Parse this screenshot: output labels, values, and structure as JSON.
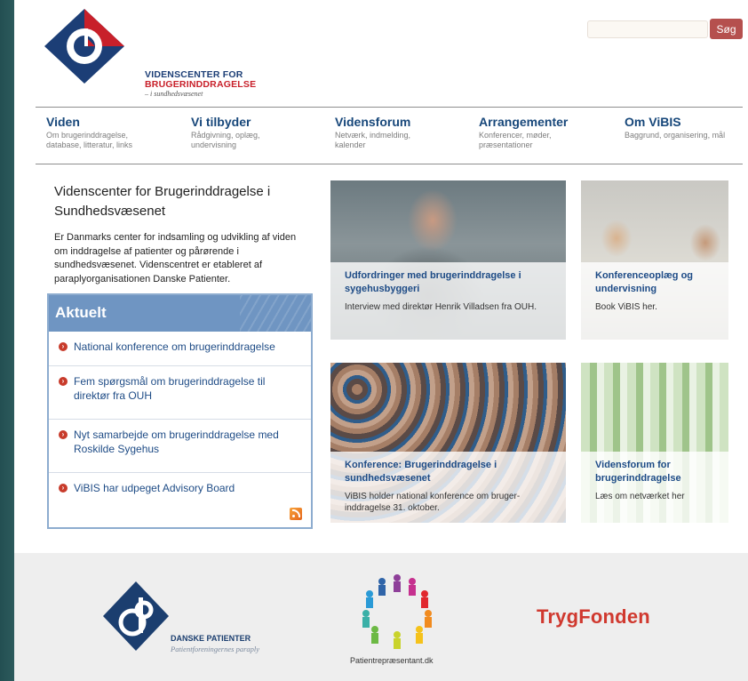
{
  "header": {
    "logo_line1": "VIDENSCENTER FOR",
    "logo_line2": "BRUGERINDDRAGELSE",
    "logo_line3": "– i sundhedsvæsenet",
    "search_placeholder": "",
    "search_button": "Søg"
  },
  "nav": [
    {
      "title": "Viden",
      "sub": "Om brugerinddragelse, database, litteratur, links"
    },
    {
      "title": "Vi tilbyder",
      "sub": "Rådgivning, oplæg, undervisning"
    },
    {
      "title": "Vidensforum",
      "sub": "Netværk, indmelding, kalender"
    },
    {
      "title": "Arrangementer",
      "sub": "Konferencer, møder, præsentationer"
    },
    {
      "title": "Om ViBIS",
      "sub": "Baggrund, organisering, mål"
    }
  ],
  "intro": {
    "title": "Videnscenter for Brugerinddragelse i Sundhedsvæsenet",
    "body": "Er Danmarks center for indsamling og udvikling af viden om inddragelse af patienter og pårørende i sundhedsvæsenet. Videnscentret er etableret af paraplyorganisationen Danske Patienter."
  },
  "aktuelt": {
    "heading": "Aktuelt",
    "items": [
      {
        "label": "National konference om brugerinddragelse"
      },
      {
        "label": "Fem spørgsmål om brugerinddragelse til direktør fra OUH"
      },
      {
        "label": "Nyt samarbejde om brugerinddragelse med Roskilde Sygehus"
      },
      {
        "label": "ViBIS har udpeget Advisory Board"
      }
    ]
  },
  "tiles": [
    {
      "title": "Udfordringer med brugerinddragelse i sygehusbyggeri",
      "text": "Interview med direktør Henrik Villadsen fra OUH."
    },
    {
      "title": "Konferenceoplæg og undervisning",
      "text": "Book ViBIS her."
    },
    {
      "title": "Konference: Brugerinddragelse i sundhedsvæsenet",
      "text": "ViBIS holder national konference om bruger-inddragelse 31. oktober."
    },
    {
      "title": "Vidensforum for brugerinddragelse",
      "text": "Læs om netværket her"
    }
  ],
  "footer": {
    "danske_patienter_name": "DANSKE PATIENTER",
    "danske_patienter_sub": "Patientforeningernes paraply",
    "patientrep_label": "Patientrepræsentant.dk",
    "tryg_brand": "TrygFonden"
  },
  "colors": {
    "nav_title": "#17477a",
    "accent_red": "#c8202a",
    "aktuelt_blue": "#6f95c2",
    "link_blue": "#1f4c86",
    "search_button": "#b5504e",
    "tryg_red": "#d0392f",
    "desktop_teal": "#1e4a4c"
  },
  "icons": [
    "vibis-logo",
    "search-button",
    "bullet-icon",
    "rss-icon",
    "danske-patienter-logo",
    "patientrep-logo"
  ]
}
